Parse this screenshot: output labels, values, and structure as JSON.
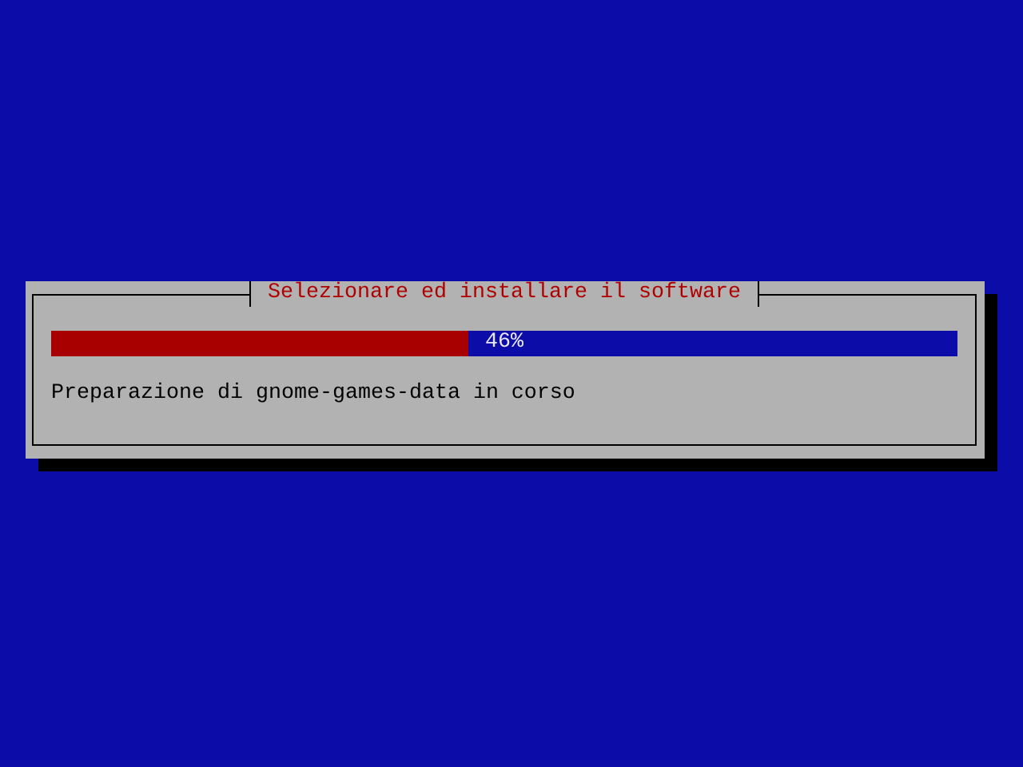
{
  "dialog": {
    "title": "Selezionare ed installare il software",
    "progress": {
      "level": 0.46,
      "reading": "46%"
    },
    "message": "Preparazione di gnome-games-data in corso"
  }
}
